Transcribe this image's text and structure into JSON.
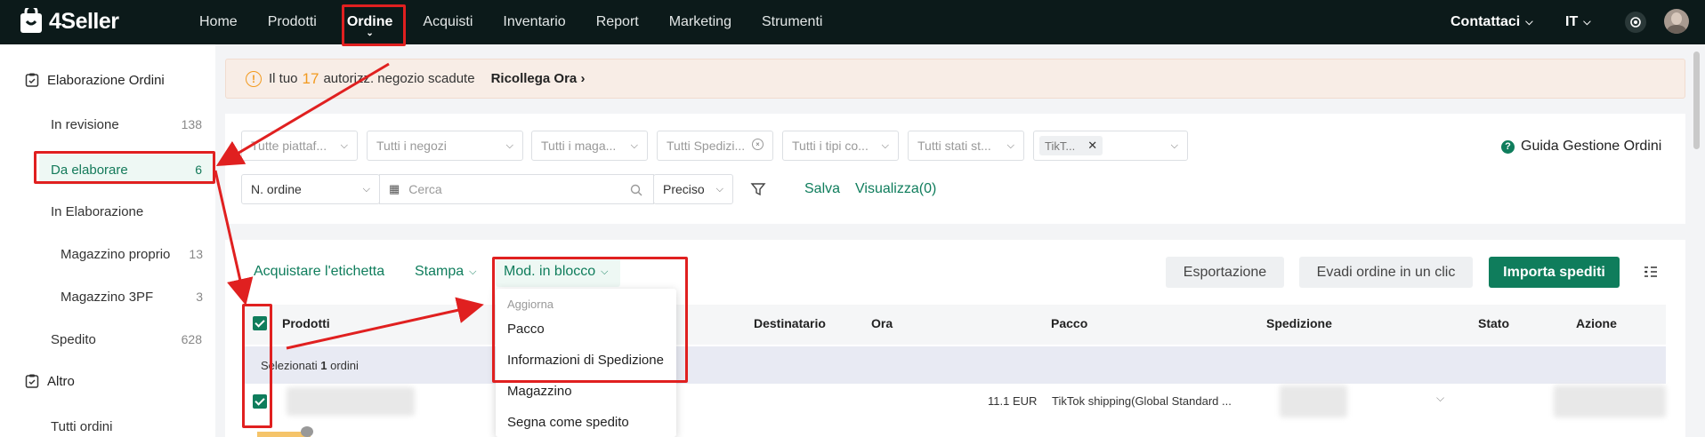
{
  "app": {
    "logo_text": "4Seller"
  },
  "nav": {
    "items": [
      "Home",
      "Prodotti",
      "Ordine",
      "Acquisti",
      "Inventario",
      "Report",
      "Marketing",
      "Strumenti"
    ]
  },
  "topbar": {
    "contact": "Contattaci",
    "language": "IT"
  },
  "sidebar": {
    "group1": "Elaborazione Ordini",
    "items": [
      {
        "label": "In revisione",
        "count": "138"
      },
      {
        "label": "Da elaborare",
        "count": "6"
      },
      {
        "label": "In Elaborazione",
        "count": ""
      },
      {
        "label": "Magazzino proprio",
        "count": "13"
      },
      {
        "label": "Magazzino 3PF",
        "count": "3"
      },
      {
        "label": "Spedito",
        "count": "628"
      }
    ],
    "group2": "Altro",
    "item_all": "Tutti ordini"
  },
  "banner": {
    "prefix": "Il tuo",
    "count": "17",
    "suffix": "autorizz. negozio scadute",
    "link": "Ricollega Ora"
  },
  "filters": {
    "platform": "Tutte piattaf...",
    "shops": "Tutti i negozi",
    "warehouses": "Tutti i maga...",
    "shipping": "Tutti Spedizi...",
    "types": "Tutti i tipi co...",
    "status": "Tutti stati st...",
    "tag": "TikT...",
    "guide": "Guida Gestione Ordini",
    "order_field": "N. ordine",
    "search_placeholder": "Cerca",
    "match": "Preciso",
    "save": "Salva",
    "view": "Visualizza(0)"
  },
  "toolbar": {
    "buy_label": "Acquistare l'etichetta",
    "print": "Stampa",
    "bulk_edit": "Mod. in blocco",
    "export": "Esportazione",
    "one_click": "Evadi ordine in un clic",
    "import_shipped": "Importa spediti"
  },
  "menu": {
    "header": "Aggiorna",
    "items": [
      "Pacco",
      "Informazioni di Spedizione",
      "Magazzino",
      "Segna come spedito"
    ]
  },
  "table": {
    "headers": [
      "Prodotti",
      "Destinatario",
      "Ora",
      "Pacco",
      "Spedizione",
      "Stato",
      "Azione"
    ],
    "selected_prefix": "Selezionati",
    "selected_count": "1",
    "selected_suffix": "ordini",
    "row": {
      "amount": "11.1 EUR",
      "shipping": "TikTok shipping(Global Standard ..."
    }
  },
  "colors": {
    "accent": "#0f7d5c",
    "topbar": "#0c1a1a",
    "annotation": "#e02020",
    "warning": "#f29a1f"
  }
}
